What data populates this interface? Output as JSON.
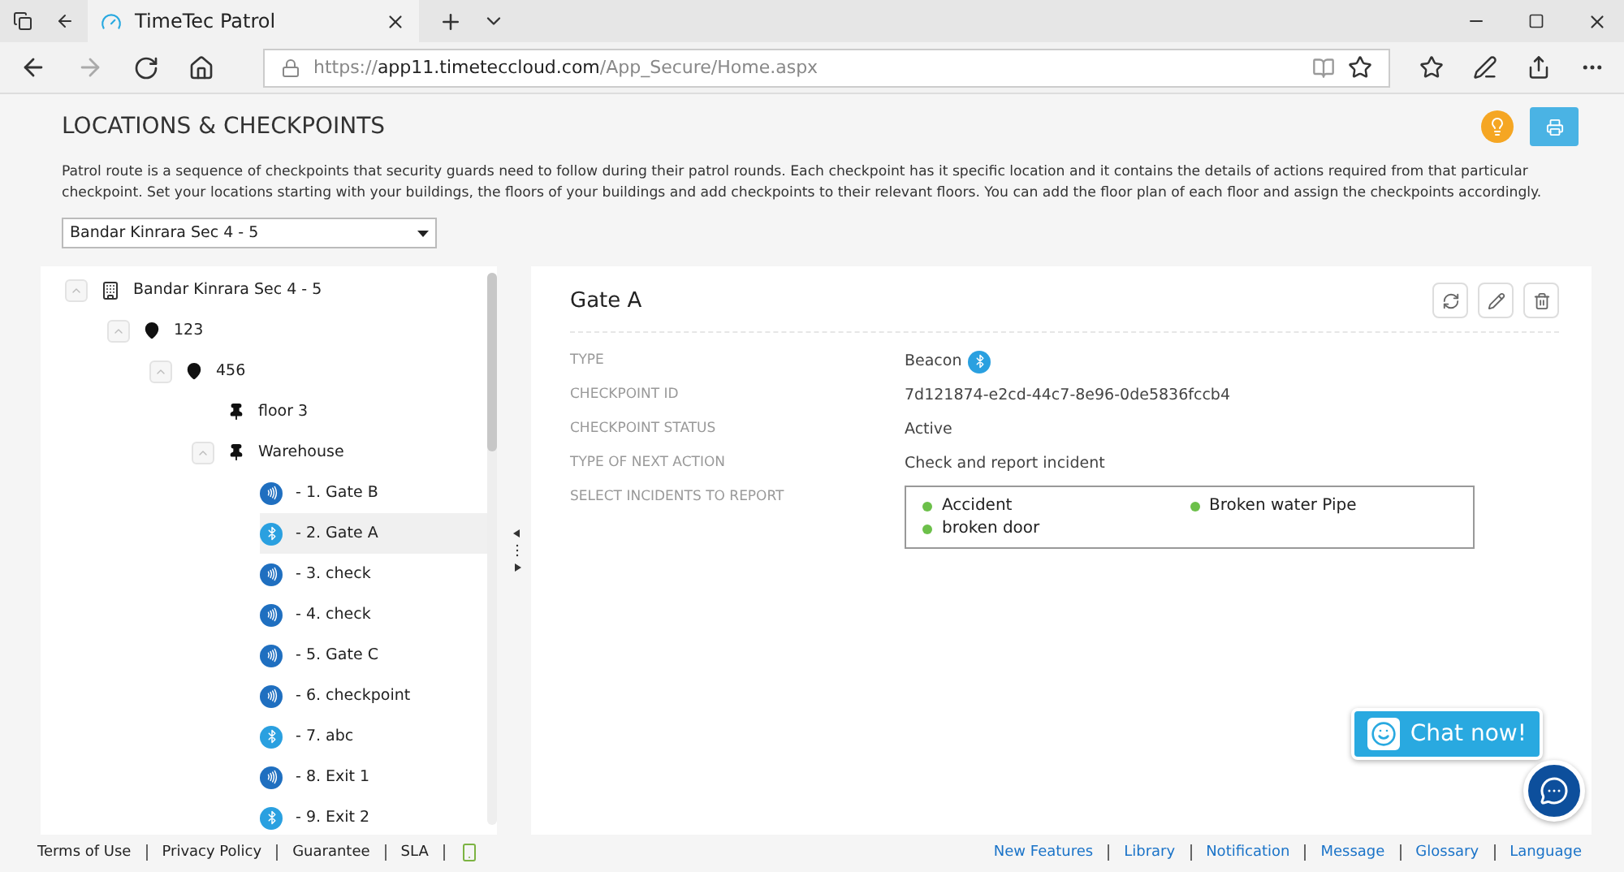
{
  "browser": {
    "tab_title": "TimeTec Patrol",
    "url": [
      {
        "text": "https://",
        "strong": false
      },
      {
        "text": "app11.timeteccloud.com",
        "strong": true
      },
      {
        "text": "/App_Secure/Home.aspx",
        "strong": false
      }
    ]
  },
  "page": {
    "title": "LOCATIONS & CHECKPOINTS",
    "description": "Patrol route is a sequence of checkpoints that security guards need to follow during their patrol rounds. Each checkpoint has it specific location and it contains the details of actions required from that particular checkpoint. Set your locations starting with your buildings, the floors of your buildings and add checkpoints to their relevant floors. You can add the floor plan of each floor and assign the checkpoints accordingly.",
    "location_select": {
      "value": "Bandar Kinrara Sec 4 - 5"
    }
  },
  "tree": [
    {
      "label": "Bandar Kinrara Sec 4 - 5",
      "kind": "building",
      "expanded": true,
      "children": [
        {
          "label": "123",
          "kind": "location",
          "expanded": true,
          "children": [
            {
              "label": "456",
              "kind": "location",
              "expanded": true,
              "children": [
                {
                  "label": "floor 3",
                  "kind": "floor"
                },
                {
                  "label": "Warehouse",
                  "kind": "floor",
                  "expanded": true,
                  "children": [
                    {
                      "number": "- 1.",
                      "label": "Gate B",
                      "kind": "nfc",
                      "selected": false
                    },
                    {
                      "number": "- 2.",
                      "label": "Gate A",
                      "kind": "beacon",
                      "selected": true
                    },
                    {
                      "number": "- 3.",
                      "label": "check",
                      "kind": "nfc",
                      "selected": false
                    },
                    {
                      "number": "- 4.",
                      "label": "check",
                      "kind": "nfc",
                      "selected": false
                    },
                    {
                      "number": "- 5.",
                      "label": "Gate C",
                      "kind": "nfc",
                      "selected": false
                    },
                    {
                      "number": "- 6.",
                      "label": "checkpoint",
                      "kind": "nfc",
                      "selected": false
                    },
                    {
                      "number": "- 7.",
                      "label": "abc",
                      "kind": "beacon",
                      "selected": false
                    },
                    {
                      "number": "- 8.",
                      "label": "Exit 1",
                      "kind": "nfc",
                      "selected": false
                    },
                    {
                      "number": "- 9.",
                      "label": "Exit 2",
                      "kind": "beacon",
                      "selected": false
                    }
                  ]
                }
              ]
            }
          ]
        }
      ]
    }
  ],
  "detail": {
    "title": "Gate A",
    "fields": [
      {
        "label": "TYPE",
        "value": "Beacon",
        "kind": "beacon"
      },
      {
        "label": "CHECKPOINT ID",
        "value": "7d121874-e2cd-44c7-8e96-0de5836fccb4",
        "kind": "text"
      },
      {
        "label": "CHECKPOINT STATUS",
        "value": "Active",
        "kind": "text"
      },
      {
        "label": "TYPE OF NEXT ACTION",
        "value": "Check and report incident",
        "kind": "text"
      },
      {
        "label": "SELECT INCIDENTS TO REPORT",
        "kind": "incidents",
        "incidents": [
          {
            "label": "Accident",
            "color": "#6cc04a"
          },
          {
            "label": "Broken water Pipe",
            "color": "#6cc04a"
          },
          {
            "label": "broken door",
            "color": "#6cc04a"
          }
        ]
      }
    ]
  },
  "footer": {
    "left": [
      "Terms of Use",
      "Privacy Policy",
      "Guarantee",
      "SLA"
    ],
    "right": [
      "New Features",
      "Library",
      "Notification",
      "Message",
      "Glossary",
      "Language"
    ]
  },
  "chat": {
    "label": "Chat now!"
  }
}
